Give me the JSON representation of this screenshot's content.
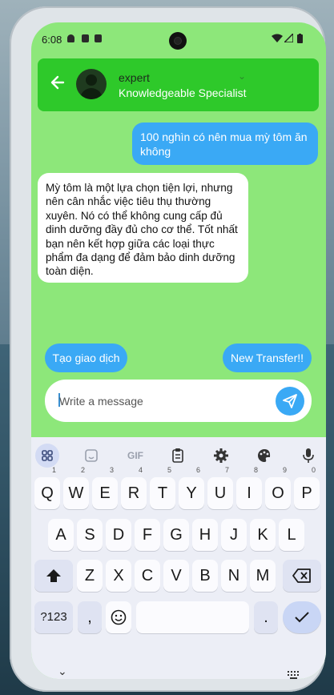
{
  "status_bar": {
    "time": "6:08"
  },
  "header": {
    "name": "expert",
    "subtitle": "Knowledgeable Specialist"
  },
  "messages": [
    {
      "from": "user",
      "text": "100 nghìn có nên mua mỳ tôm ăn không"
    },
    {
      "from": "bot",
      "text": "Mỳ tôm là một lựa chọn tiện lợi, nhưng nên cân nhắc việc tiêu thụ thường xuyên. Nó có thể không cung cấp đủ dinh dưỡng đầy đủ cho cơ thể. Tốt nhất bạn nên kết hợp giữa các loại thực phẩm đa dạng để đảm bảo dinh dưỡng toàn diện."
    }
  ],
  "quick_actions": [
    "Tạo giao dịch",
    "New Transfer!!"
  ],
  "composer": {
    "placeholder": "Write a message",
    "value": ""
  },
  "keyboard": {
    "toolbar_gif": "GIF",
    "row1": [
      {
        "k": "Q",
        "h": "1"
      },
      {
        "k": "W",
        "h": "2"
      },
      {
        "k": "E",
        "h": "3"
      },
      {
        "k": "R",
        "h": "4"
      },
      {
        "k": "T",
        "h": "5"
      },
      {
        "k": "Y",
        "h": "6"
      },
      {
        "k": "U",
        "h": "7"
      },
      {
        "k": "I",
        "h": "8"
      },
      {
        "k": "O",
        "h": "9"
      },
      {
        "k": "P",
        "h": "0"
      }
    ],
    "row2": [
      "A",
      "S",
      "D",
      "F",
      "G",
      "H",
      "J",
      "K",
      "L"
    ],
    "row3": [
      "Z",
      "X",
      "C",
      "V",
      "B",
      "N",
      "M"
    ],
    "sym_label": "?123",
    "comma": ",",
    "period": "."
  },
  "colors": {
    "chat_background": "#8de77a",
    "header": "#2ec92a",
    "accent_blue": "#3aa9f5"
  }
}
